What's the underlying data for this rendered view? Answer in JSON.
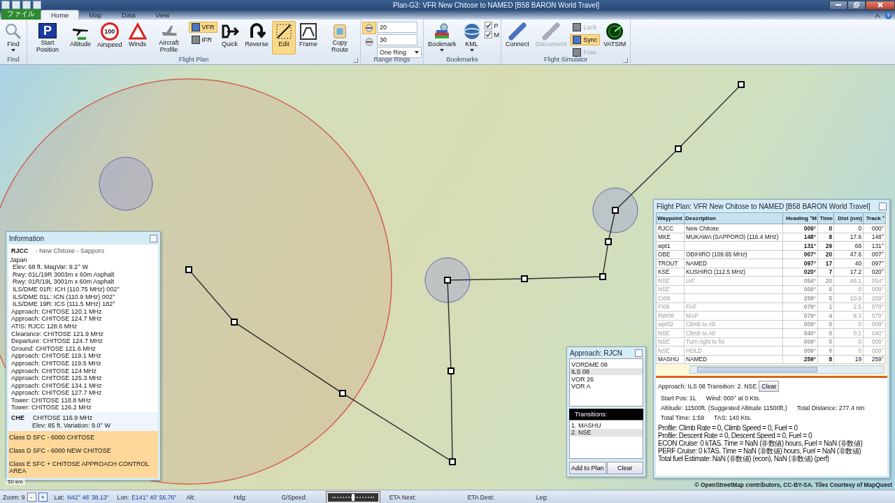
{
  "window": {
    "title": "Plan-G3: VFR New Chitose to NAMED [B58 BARON World Travel]"
  },
  "tabs": [
    {
      "label": "ファイル",
      "kind": "file",
      "selected": false
    },
    {
      "label": "Home",
      "kind": "tab",
      "selected": true
    },
    {
      "label": "Map",
      "kind": "tab",
      "selected": false
    },
    {
      "label": "Data",
      "kind": "tab",
      "selected": false
    },
    {
      "label": "View",
      "kind": "tab",
      "selected": false
    }
  ],
  "ribbon": [
    {
      "label": "Find",
      "items": [
        {
          "kind": "large",
          "label": "Find",
          "dropdown": true
        }
      ]
    },
    {
      "label": "Flight Plan",
      "launcher": true,
      "items": [
        {
          "kind": "large",
          "label": "Start Position",
          "icon_text": "P"
        },
        {
          "kind": "large",
          "label": "Altitude"
        },
        {
          "kind": "large",
          "label": "Airspeed",
          "icon_text": "100"
        },
        {
          "kind": "large",
          "label": "Winds"
        },
        {
          "kind": "large",
          "label": "Aircraft Profile"
        },
        {
          "kind": "stack",
          "children": [
            {
              "kind": "toggle",
              "label": "VFR",
              "selected": true
            },
            {
              "kind": "toggle",
              "label": "IFR",
              "selected": false
            }
          ]
        },
        {
          "kind": "large",
          "label": "Quick"
        },
        {
          "kind": "large",
          "label": "Reverse"
        },
        {
          "kind": "large-toggle",
          "label": "Edit",
          "selected": true
        },
        {
          "kind": "large",
          "label": "Frame"
        },
        {
          "kind": "large",
          "label": "Copy Route"
        }
      ]
    },
    {
      "label": "Range Rings",
      "items": [
        {
          "kind": "stack",
          "children": [
            {
              "kind": "icon-toggle",
              "selected": true
            },
            {
              "kind": "icon-toggle",
              "selected": false
            }
          ]
        },
        {
          "kind": "stack",
          "children": [
            {
              "kind": "input",
              "value": "20"
            },
            {
              "kind": "input",
              "value": "30"
            },
            {
              "kind": "dropdown",
              "value": "One Ring"
            }
          ]
        }
      ]
    },
    {
      "label": "Bookmarks",
      "items": [
        {
          "kind": "large",
          "label": "Bookmark",
          "dropdown": true
        },
        {
          "kind": "large",
          "label": "KML",
          "dropdown": true
        },
        {
          "kind": "stack",
          "children": [
            {
              "kind": "check",
              "label": "P",
              "checked": true
            },
            {
              "kind": "check",
              "label": "M",
              "checked": true
            }
          ]
        }
      ]
    },
    {
      "label": "Flight Simulator",
      "launcher": true,
      "items": [
        {
          "kind": "large",
          "label": "Connect",
          "disabled": false
        },
        {
          "kind": "large",
          "label": "Disconnect",
          "disabled": true
        },
        {
          "kind": "stack",
          "children": [
            {
              "kind": "small",
              "label": "Lock",
              "disabled": true,
              "selected": false
            },
            {
              "kind": "small",
              "label": "Sync",
              "disabled": false,
              "selected": true
            },
            {
              "kind": "small",
              "label": "Free",
              "disabled": true,
              "selected": false
            }
          ]
        },
        {
          "kind": "large",
          "label": "VATSIM",
          "disabled": false
        }
      ]
    }
  ],
  "information": {
    "title": "Information",
    "ident": "RJCC",
    "name": "- New Chitose - Sapporo",
    "country": "Japan",
    "details": [
      "Elev: 68 ft. MagVar: 9.2° W",
      "Rwy: 01L/19R 3003m x 60m Asphalt",
      "Rwy: 01R/19L 3001m x 60m Asphalt",
      "ILS/DME 01R: ICH (110.75 MHz) 002°",
      "ILS/DME 01L: ICN (110.9 MHz) 002°",
      "ILS/DME 19R: ICS (111.5 MHz) 182°"
    ],
    "frequencies": [
      "Approach: CHITOSE 120.1 MHz",
      "Approach: CHITOSE 124.7 MHz",
      "ATIS: RJCC 128.6 MHz",
      "Clearance: CHITOSE 121.9 MHz",
      "Departure: CHITOSE 124.7 MHz",
      "Ground: CHITOSE 121.6 MHz",
      "Approach: CHITOSE 119.1 MHz",
      "Approach: CHITOSE 119.5 MHz",
      "Approach: CHITOSE 124 MHz",
      "Approach: CHITOSE 125.3 MHz",
      "Approach: CHITOSE 134.1 MHz",
      "Approach: CHITOSE 127.7 MHz",
      "Tower: CHITOSE 118.8 MHz",
      "Tower: CHITOSE 126.2 MHz"
    ],
    "navaid": {
      "ident": "CHE",
      "name": "CHITOSE 116.9 MHz",
      "detail": "Elev: 85 ft. Variation: 9.0° W"
    },
    "airspaces": [
      "Class D SFC - 6000 CHITOSE",
      "Class D SFC - 6000 NEW CHITOSE",
      "Class E SFC + CHITOSE APPROACH CONTROL AREA"
    ]
  },
  "approach": {
    "title": "Approach: RJCN",
    "approaches": [
      {
        "label": "VORDME 08",
        "selected": false
      },
      {
        "label": "ILS 08",
        "selected": true
      },
      {
        "label": "VOR 26",
        "selected": false
      },
      {
        "label": "VOR  A",
        "selected": false
      }
    ],
    "transitions_title": "Transitions:",
    "transitions": [
      {
        "label": "1. MASHU",
        "selected": false
      },
      {
        "label": "2. NSE",
        "selected": true
      }
    ],
    "buttons": [
      "Add to Plan",
      "Clear"
    ]
  },
  "flight_plan": {
    "title": "Flight Plan: VFR New Chitose to NAMED [B58 BARON World Travel]",
    "columns": [
      "Waypoint",
      "Description",
      "Heading °M",
      "Time",
      "Dist (nm)",
      "Track °"
    ],
    "rows": [
      {
        "waypoint": "RJCC",
        "description": "New Chitose",
        "heading": "009°",
        "time": "0",
        "dist": "0",
        "track": "000°",
        "dimmed": false
      },
      {
        "waypoint": "MKE",
        "description": "MUKAWA (SAPPORO) (116.4 MHz)",
        "heading": "148°",
        "time": "8",
        "dist": "17.6",
        "track": "148°",
        "dimmed": false
      },
      {
        "waypoint": "wpt1",
        "description": "",
        "heading": "131°",
        "time": "29",
        "dist": "68",
        "track": "131°",
        "dimmed": false
      },
      {
        "waypoint": "OBE",
        "description": "OBIHIRO (109.65 MHz)",
        "heading": "007°",
        "time": "20",
        "dist": "47.6",
        "track": "007°",
        "dimmed": false
      },
      {
        "waypoint": "TROUT",
        "description": "NAMED",
        "heading": "097°",
        "time": "17",
        "dist": "40",
        "track": "097°",
        "dimmed": false
      },
      {
        "waypoint": "KSE",
        "description": "KUSHIRO (112.5 MHz)",
        "heading": "020°",
        "time": "7",
        "dist": "17.2",
        "track": "020°",
        "dimmed": false
      },
      {
        "waypoint": "NSE",
        "description": "IAF",
        "heading": "054°",
        "time": "20",
        "dist": "46.1",
        "track": "054°",
        "dimmed": true
      },
      {
        "waypoint": "NSE",
        "description": "",
        "heading": "009°",
        "time": "0",
        "dist": "0",
        "track": "009°",
        "dimmed": true
      },
      {
        "waypoint": "CI08",
        "description": "",
        "heading": "259°",
        "time": "5",
        "dist": "10.9",
        "track": "259°",
        "dimmed": true
      },
      {
        "waypoint": "FI08",
        "description": "FAF",
        "heading": "079°",
        "time": "1",
        "dist": "2.5",
        "track": "079°",
        "dimmed": true
      },
      {
        "waypoint": "RW08",
        "description": "MAP",
        "heading": "079°",
        "time": "4",
        "dist": "8.3",
        "track": "079°",
        "dimmed": true
      },
      {
        "waypoint": "wpt02",
        "description": "Climb to Alt",
        "heading": "009°",
        "time": "0",
        "dist": "0",
        "track": "009°",
        "dimmed": true
      },
      {
        "waypoint": "NSE",
        "description": "Climb to Alt",
        "heading": "040°",
        "time": "0",
        "dist": "0.2",
        "track": "040°",
        "dimmed": true
      },
      {
        "waypoint": "NSE",
        "description": "Turn right to fix",
        "heading": "009°",
        "time": "0",
        "dist": "0",
        "track": "009°",
        "dimmed": true
      },
      {
        "waypoint": "NSE",
        "description": "HOLD",
        "heading": "009°",
        "time": "0",
        "dist": "0",
        "track": "009°",
        "dimmed": true
      },
      {
        "waypoint": "MASHU",
        "description": "NAMED",
        "heading": "259°",
        "time": "8",
        "dist": "19",
        "track": "259°",
        "dimmed": false
      }
    ],
    "approach_line": "Approach: ILS 08 Transition: 2. NSE",
    "clear_button": "Clear",
    "summary": [
      [
        "Start Pos: 1L",
        "Wind: 000° at 0 Kts."
      ],
      [
        "Altitude: 11500ft. (Suggested Altitude 11500ft.)",
        "Total Distance: 277.4 nm"
      ],
      [
        "Total Time: 1:59",
        "TAS: 140 Kts."
      ]
    ],
    "profile": [
      "Profile: Climb Rate = 0, Climb Speed = 0, Fuel = 0",
      "Profile: Descent Rate = 0, Descent Speed = 0, Fuel = 0",
      "ECON Cruise: 0 kTAS. Time = NaN (非数値) hours, Fuel = NaN (非数値)",
      "PERF Cruise: 0 kTAS. Time = NaN (非数値) hours, Fuel = NaN (非数値)",
      "Total fuel Estimate: NaN (非数値) (econ), NaN (非数値) (perf)"
    ]
  },
  "map": {
    "scale": "50 km",
    "attribution": "© OpenStreetMap contributors, CC-BY-SA. Tiles Courtesy of MapQuest"
  },
  "status_bar": {
    "zoom_label": "Zoom:",
    "zoom": "9",
    "zoom_out": "-",
    "zoom_in": "+",
    "lat_label": "Lat:",
    "lat": "N42° 46' 38.13\"",
    "lon_label": "Lon:",
    "lon": "E141° 40' 56.76\"",
    "alt_label": "Alt:",
    "hdg_label": "Hdg:",
    "speed_label": "G/Speed:",
    "level": 0.5,
    "eta_next_label": "ETA Next:",
    "eta_dest_label": "ETA Dest:",
    "leg_label": "Leg:"
  }
}
